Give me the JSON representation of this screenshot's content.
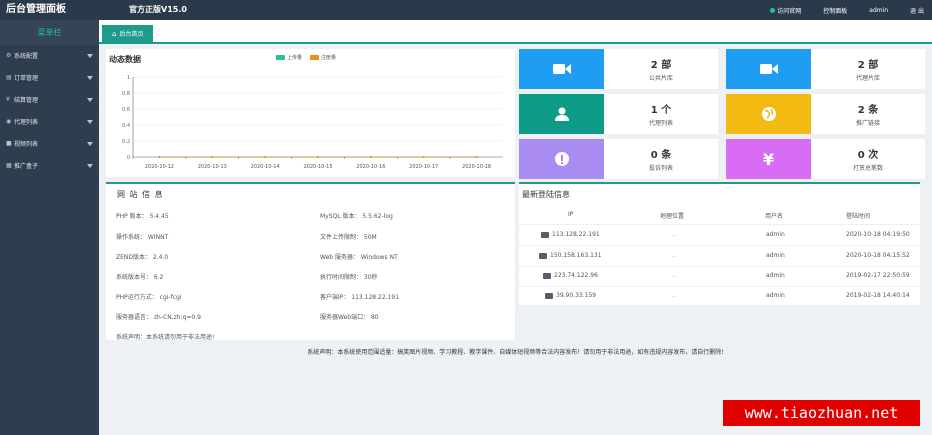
{
  "header": {
    "brand": "后台管理面板",
    "version": "官方正版V15.0",
    "links": [
      "访问官网",
      "控制面板",
      "admin",
      "退 出"
    ]
  },
  "sidebar": {
    "title": "菜单栏",
    "items": [
      {
        "icon": "gear-icon",
        "label": "系统配置"
      },
      {
        "icon": "cart-icon",
        "label": "订单管理"
      },
      {
        "icon": "yen-icon",
        "label": "结算管理"
      },
      {
        "icon": "agent-icon",
        "label": "代理列表"
      },
      {
        "icon": "video-icon",
        "label": "视频列表"
      },
      {
        "icon": "box-icon",
        "label": "推广盒子"
      }
    ]
  },
  "tab": {
    "label": "后台首页"
  },
  "chart_data": {
    "type": "line",
    "title": "动态数据",
    "categories": [
      "2020-10-12",
      "2020-10-13",
      "2020-10-14",
      "2020-10-15",
      "2020-10-16",
      "2020-10-17",
      "2020-10-18"
    ],
    "series": [
      {
        "name": "上传量",
        "values": [
          0,
          0,
          0,
          0,
          0,
          0,
          0
        ],
        "color": "#27c291"
      },
      {
        "name": "注册量",
        "values": [
          0,
          0,
          0,
          0,
          0,
          0,
          0
        ],
        "color": "#f08a24"
      }
    ],
    "yticks": [
      "0",
      "0.2",
      "0.4",
      "0.6",
      "0.8",
      "1"
    ],
    "ylim": [
      0,
      1
    ],
    "grid": true,
    "legend": "top-center"
  },
  "cards": [
    {
      "value": "2 部",
      "label": "公共片库",
      "color": "#1e9df2",
      "icon": "video-camera-icon"
    },
    {
      "value": "2 部",
      "label": "代理片库",
      "color": "#1e9df2",
      "icon": "video-camera-icon"
    },
    {
      "value": "1 个",
      "label": "代理列表",
      "color": "#0e9b88",
      "icon": "user-icon"
    },
    {
      "value": "2 条",
      "label": "推广链接",
      "color": "#f3bb12",
      "icon": "globe-icon"
    },
    {
      "value": "0 条",
      "label": "投诉列表",
      "color": "#a98cf2",
      "icon": "alert-icon"
    },
    {
      "value": "0 次",
      "label": "打赏总笔数",
      "color": "#d96cf4",
      "icon": "yen-icon"
    }
  ],
  "site_info": {
    "title": "网 站 信 息",
    "left": [
      "PHP 版本： 5.4.45",
      "操作系统： WINNT",
      "ZEND版本： 2.4.0",
      "系统版本号： 6.2",
      "PHP运行方式： cgi-fcgi",
      "服务器语言： zh-CN,zh;q=0.9",
      "系统声明：本系统请勿用于非法用途!"
    ],
    "right": [
      "MySQL 版本： 5.5.62-log",
      "文件上传限制： 50M",
      "Web 服务器： Windows NT",
      "执行时间限制： 30秒",
      "客户端IP： 113.128.22.191",
      "服务器Web端口： 80"
    ]
  },
  "login_info": {
    "title": "最新登陆信息",
    "columns": [
      "IP",
      "地理位置",
      "用户名",
      "登陆时间"
    ],
    "rows": [
      {
        "ip": "113.128.22.191",
        "location": ".",
        "user": "admin",
        "time": "2020-10-18 04:19:50"
      },
      {
        "ip": "150.158.163.131",
        "location": ".",
        "user": "admin",
        "time": "2020-10-18 04:15:52"
      },
      {
        "ip": "223.74.122.96",
        "location": ".",
        "user": "admin",
        "time": "2019-02-17 22:50:59"
      },
      {
        "ip": "39.90.33.159",
        "location": ".",
        "user": "admin",
        "time": "2019-02-18 14:40:14"
      }
    ]
  },
  "footer_note": "系统声明：本系统使用范围适量：搞笑图片视频、学习教程、教学课件、自媒体短视频等合法内容发布！请勿用于非法用途，如有违规内容发布，请自行删除!",
  "watermark": "www.tiaozhuan.net"
}
